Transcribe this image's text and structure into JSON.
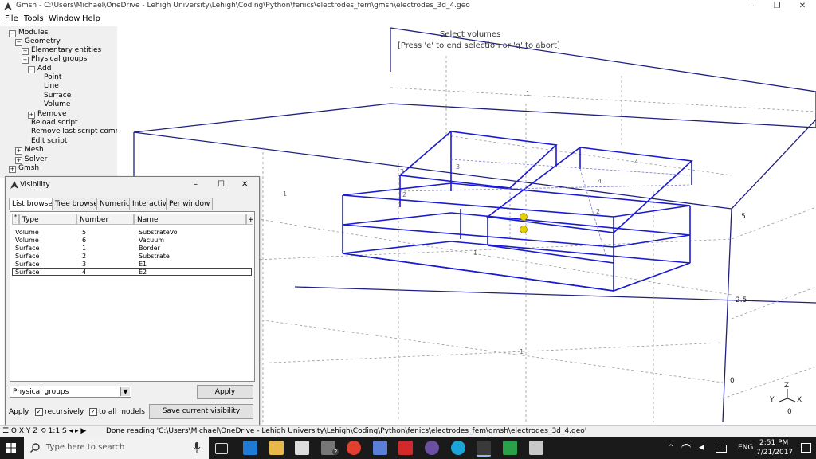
{
  "window": {
    "title": "Gmsh - C:\\Users\\Michael\\OneDrive - Lehigh University\\Lehigh\\Coding\\Python\\fenics\\electrodes_fem\\gmsh\\electrodes_3d_4.geo",
    "minimize": "–",
    "maximize": "❐",
    "close": "✕"
  },
  "menu": [
    "File",
    "Tools",
    "Window",
    "Help"
  ],
  "tree": {
    "modules": "Modules",
    "geometry": "Geometry",
    "elementary": "Elementary entities",
    "physical": "Physical groups",
    "add": "Add",
    "point": "Point",
    "line": "Line",
    "surface": "Surface",
    "volume": "Volume",
    "remove": "Remove",
    "reload": "Reload script",
    "remove_last": "Remove last script comm",
    "edit": "Edit script",
    "mesh": "Mesh",
    "solver": "Solver",
    "gmsh": "Gmsh"
  },
  "graphics": {
    "prompt": "Select volumes",
    "hint": "[Press 'e' to end selection or 'q' to abort]",
    "axis_labels": {
      "top": "5",
      "mid": "2.5",
      "bottom": "0",
      "bottom2": "0"
    },
    "axes": {
      "x": "X",
      "y": "Y",
      "z": "Z"
    },
    "tick_marks": [
      "1",
      "1",
      "1",
      "2",
      "3",
      "3",
      "4",
      "4",
      "1",
      "2"
    ]
  },
  "visibility": {
    "title": "Visibility",
    "tabs": [
      "List browser",
      "Tree browser",
      "Numeric",
      "Interactive",
      "Per window"
    ],
    "columns": [
      "Type",
      "Number",
      "Name"
    ],
    "rows": [
      {
        "type": "Volume",
        "number": "5",
        "name": "SubstrateVol"
      },
      {
        "type": "Volume",
        "number": "6",
        "name": "Vacuum"
      },
      {
        "type": "Surface",
        "number": "1",
        "name": "Border"
      },
      {
        "type": "Surface",
        "number": "2",
        "name": "Substrate"
      },
      {
        "type": "Surface",
        "number": "3",
        "name": "E1"
      },
      {
        "type": "Surface",
        "number": "4",
        "name": "E2"
      }
    ],
    "dropdown": "Physical groups",
    "apply": "Apply",
    "apply_label": "Apply",
    "recursively": "recursively",
    "to_all_models": "to all models",
    "save": "Save current visibility",
    "minimize": "–",
    "maximize": "☐",
    "close": "✕"
  },
  "statusbar": {
    "controls": "☰ O X Y Z ⟲ 1:1 S ◂ ▸ ▶",
    "message": "Done reading 'C:\\Users\\Michael\\OneDrive - Lehigh University\\Lehigh\\Coding\\Python\\fenics\\electrodes_fem\\gmsh\\electrodes_3d_4.geo'"
  },
  "taskbar": {
    "search_placeholder": "Type here to search",
    "lang": "ENG",
    "time": "2:51 PM",
    "date": "7/21/2017",
    "badge": "2"
  },
  "colors": {
    "geometry": "#1a1ad0",
    "box": "#202080",
    "point": "#e8d000"
  }
}
